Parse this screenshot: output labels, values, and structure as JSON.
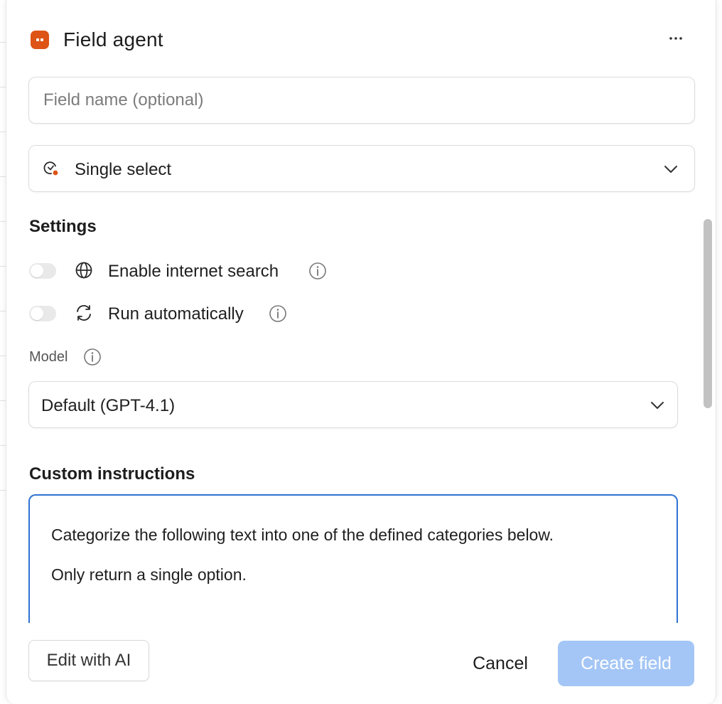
{
  "header": {
    "title": "Field agent",
    "app_icon": "field-agent-icon",
    "more_icon": "more-horizontal-icon",
    "accent_color": "#dd5416"
  },
  "field_name": {
    "value": "",
    "placeholder": "Field name (optional)"
  },
  "field_type": {
    "selected": "Single select",
    "icon": "single-select-icon"
  },
  "settings": {
    "heading": "Settings",
    "internet_search": {
      "label": "Enable internet search",
      "enabled": false,
      "icon": "globe-icon"
    },
    "run_automatically": {
      "label": "Run automatically",
      "enabled": false,
      "icon": "refresh-icon"
    }
  },
  "model": {
    "label": "Model",
    "selected": "Default (GPT-4.1)"
  },
  "custom_instructions": {
    "heading": "Custom instructions",
    "lines": [
      "Categorize the following text into one of the defined categories below.",
      "Only return a single option."
    ],
    "focus_color": "#2f72d1"
  },
  "footer": {
    "edit_ai_label": "Edit with AI",
    "cancel_label": "Cancel",
    "create_label": "Create field",
    "create_color": "#a4c6f6"
  }
}
